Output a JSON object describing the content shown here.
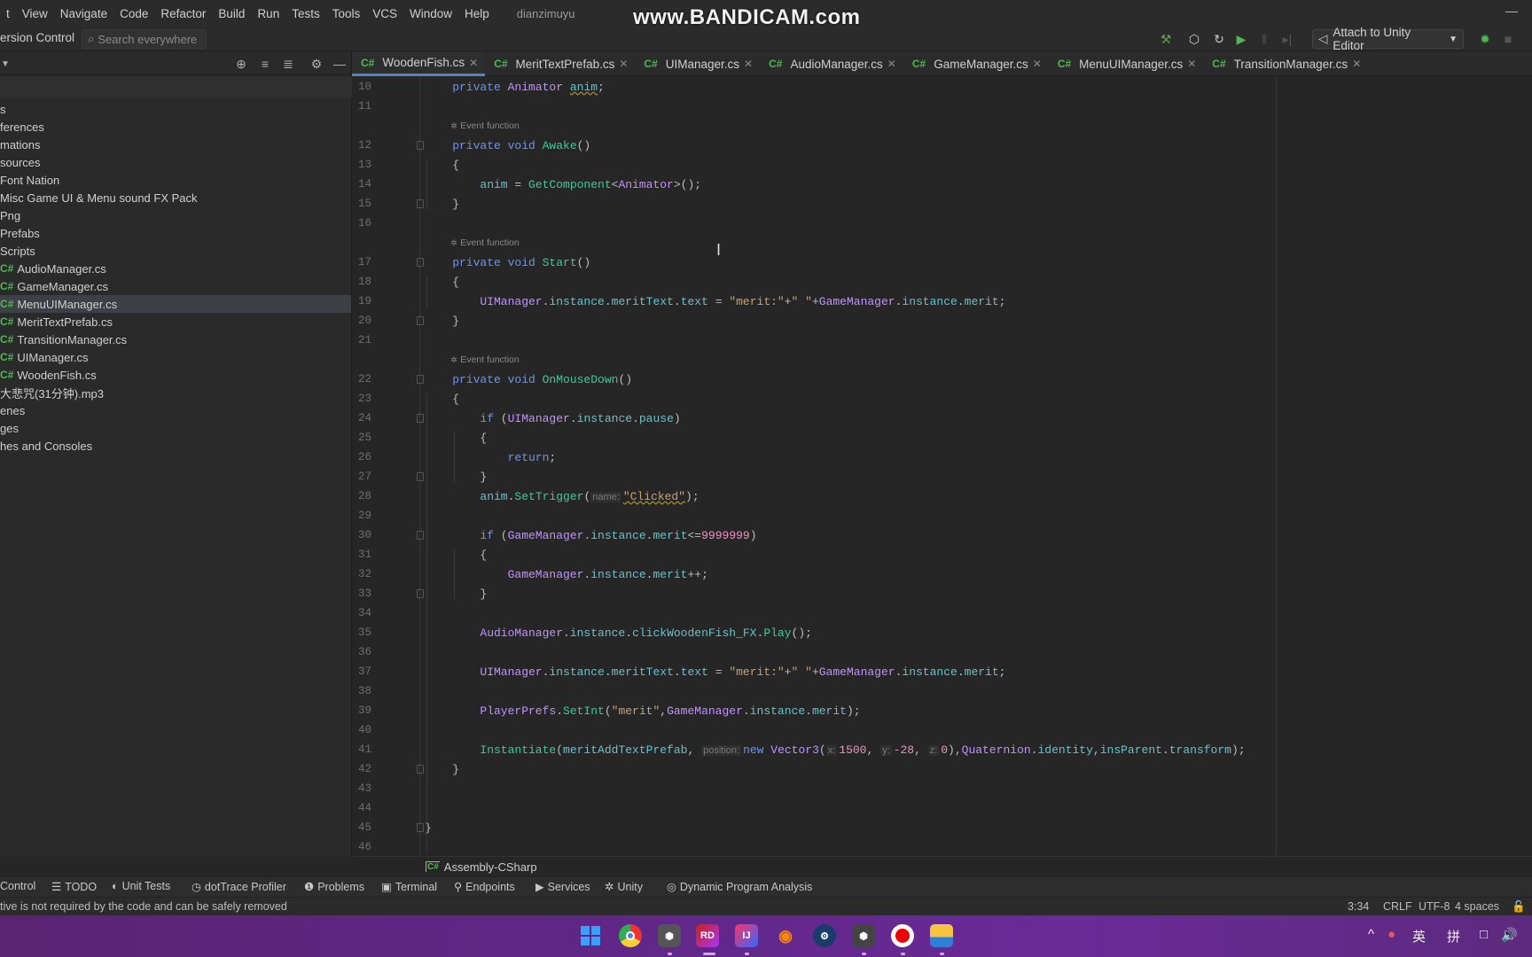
{
  "menubar": {
    "items": [
      "t",
      "View",
      "Navigate",
      "Code",
      "Refactor",
      "Build",
      "Run",
      "Tests",
      "Tools",
      "VCS",
      "Window",
      "Help"
    ],
    "project": "dianzimuyu"
  },
  "watermark": "www.BANDICAM.com",
  "toolbar": {
    "vcs_label": "ersion Control",
    "search_placeholder": "Search everywhere",
    "attach_label": "Attach to Unity Editor",
    "icons": [
      "hammer-icon",
      "unity-icon",
      "refresh-icon",
      "run-icon",
      "pause-icon",
      "step-icon",
      "debug-icon",
      "stop-icon"
    ]
  },
  "sidebar": {
    "items": [
      {
        "label": "s",
        "cs": false
      },
      {
        "label": "ferences",
        "cs": false
      },
      {
        "label": "mations",
        "cs": false
      },
      {
        "label": "sources",
        "cs": false
      },
      {
        "label": "Font Nation",
        "cs": false
      },
      {
        "label": "Misc Game UI & Menu sound FX Pack",
        "cs": false
      },
      {
        "label": "Png",
        "cs": false
      },
      {
        "label": "Prefabs",
        "cs": false
      },
      {
        "label": "Scripts",
        "cs": false
      },
      {
        "label": "AudioManager.cs",
        "cs": true
      },
      {
        "label": "GameManager.cs",
        "cs": true
      },
      {
        "label": "MenuUIManager.cs",
        "cs": true,
        "selected": true
      },
      {
        "label": "MeritTextPrefab.cs",
        "cs": true
      },
      {
        "label": "TransitionManager.cs",
        "cs": true
      },
      {
        "label": "UIManager.cs",
        "cs": true
      },
      {
        "label": "WoodenFish.cs",
        "cs": true
      },
      {
        "label": "大悲咒(31分钟).mp3",
        "cs": false
      },
      {
        "label": "enes",
        "cs": false
      },
      {
        "label": "ges",
        "cs": false
      },
      {
        "label": "hes and Consoles",
        "cs": false
      }
    ]
  },
  "tabs": [
    {
      "label": "WoodenFish.cs",
      "active": true
    },
    {
      "label": "MeritTextPrefab.cs"
    },
    {
      "label": "UIManager.cs"
    },
    {
      "label": "AudioManager.cs"
    },
    {
      "label": "GameManager.cs"
    },
    {
      "label": "MenuUIManager.cs"
    },
    {
      "label": "TransitionManager.cs"
    }
  ],
  "cs_badge": "C#",
  "editor": {
    "rows": [
      {
        "n": "10",
        "i": 1,
        "t": [
          [
            "kw",
            "private "
          ],
          [
            "cls",
            "Animator "
          ],
          [
            "fld u",
            "anim"
          ],
          [
            "p",
            ";"
          ]
        ]
      },
      {
        "n": "11"
      },
      {
        "hint": "Event function",
        "i": 1
      },
      {
        "n": "12",
        "i": 1,
        "f": 1,
        "t": [
          [
            "kw",
            "private void "
          ],
          [
            "mth",
            "Awake"
          ],
          [
            "p",
            "()"
          ]
        ]
      },
      {
        "n": "13",
        "i": 1,
        "t": [
          [
            "p",
            "{"
          ]
        ]
      },
      {
        "n": "14",
        "i": 2,
        "t": [
          [
            "fld",
            "anim"
          ],
          [
            "p",
            " = "
          ],
          [
            "mth",
            "GetComponent"
          ],
          [
            "p",
            "<"
          ],
          [
            "cls",
            "Animator"
          ],
          [
            "p",
            ">();"
          ]
        ]
      },
      {
        "n": "15",
        "i": 1,
        "f": 1,
        "t": [
          [
            "p",
            "}"
          ]
        ]
      },
      {
        "n": "16"
      },
      {
        "hint": "Event function",
        "i": 1
      },
      {
        "n": "17",
        "i": 1,
        "f": 1,
        "t": [
          [
            "kw",
            "private void "
          ],
          [
            "mth",
            "Start"
          ],
          [
            "p",
            "()"
          ]
        ]
      },
      {
        "n": "18",
        "i": 1,
        "t": [
          [
            "p",
            "{"
          ]
        ]
      },
      {
        "n": "19",
        "i": 2,
        "t": [
          [
            "cls",
            "UIManager"
          ],
          [
            "p",
            "."
          ],
          [
            "fld",
            "instance"
          ],
          [
            "p",
            "."
          ],
          [
            "fld",
            "meritText"
          ],
          [
            "p",
            "."
          ],
          [
            "fld",
            "text"
          ],
          [
            "p",
            " = "
          ],
          [
            "str",
            "\"merit:\""
          ],
          [
            "p",
            "+"
          ],
          [
            "str",
            "\" \""
          ],
          [
            "p",
            "+"
          ],
          [
            "cls",
            "GameManager"
          ],
          [
            "p",
            "."
          ],
          [
            "fld",
            "instance"
          ],
          [
            "p",
            "."
          ],
          [
            "fld",
            "merit"
          ],
          [
            "p",
            ";"
          ]
        ]
      },
      {
        "n": "20",
        "i": 1,
        "f": 1,
        "t": [
          [
            "p",
            "}"
          ]
        ]
      },
      {
        "n": "21"
      },
      {
        "hint": "Event function",
        "i": 1
      },
      {
        "n": "22",
        "i": 1,
        "f": 1,
        "t": [
          [
            "kw",
            "private void "
          ],
          [
            "mth",
            "OnMouseDown"
          ],
          [
            "p",
            "()"
          ]
        ]
      },
      {
        "n": "23",
        "i": 1,
        "t": [
          [
            "p",
            "{"
          ]
        ]
      },
      {
        "n": "24",
        "i": 2,
        "f": 1,
        "t": [
          [
            "kw",
            "if"
          ],
          [
            "p",
            " ("
          ],
          [
            "cls",
            "UIManager"
          ],
          [
            "p",
            "."
          ],
          [
            "fld",
            "instance"
          ],
          [
            "p",
            "."
          ],
          [
            "fld",
            "pause"
          ],
          [
            "p",
            ")"
          ]
        ]
      },
      {
        "n": "25",
        "i": 2,
        "t": [
          [
            "p",
            "{"
          ]
        ]
      },
      {
        "n": "26",
        "i": 3,
        "t": [
          [
            "kw",
            "return"
          ],
          [
            "p",
            ";"
          ]
        ]
      },
      {
        "n": "27",
        "i": 2,
        "f": 1,
        "t": [
          [
            "p",
            "}"
          ]
        ]
      },
      {
        "n": "28",
        "i": 2,
        "t": [
          [
            "fld",
            "anim"
          ],
          [
            "p",
            "."
          ],
          [
            "mth",
            "SetTrigger"
          ],
          [
            "p",
            "("
          ],
          [
            "ph",
            "name:"
          ],
          [
            "str u",
            "\"Clicked\""
          ],
          [
            "p",
            ");"
          ]
        ]
      },
      {
        "n": "29"
      },
      {
        "n": "30",
        "i": 2,
        "f": 1,
        "t": [
          [
            "kw",
            "if"
          ],
          [
            "p",
            " ("
          ],
          [
            "cls",
            "GameManager"
          ],
          [
            "p",
            "."
          ],
          [
            "fld",
            "instance"
          ],
          [
            "p",
            "."
          ],
          [
            "fld",
            "merit"
          ],
          [
            "p",
            "<="
          ],
          [
            "num",
            "9999999"
          ],
          [
            "p",
            ")"
          ]
        ]
      },
      {
        "n": "31",
        "i": 2,
        "t": [
          [
            "p",
            "{"
          ]
        ]
      },
      {
        "n": "32",
        "i": 3,
        "t": [
          [
            "cls",
            "GameManager"
          ],
          [
            "p",
            "."
          ],
          [
            "fld",
            "instance"
          ],
          [
            "p",
            "."
          ],
          [
            "fld",
            "merit"
          ],
          [
            "p",
            "++;"
          ]
        ]
      },
      {
        "n": "33",
        "i": 2,
        "f": 1,
        "t": [
          [
            "p",
            "}"
          ]
        ]
      },
      {
        "n": "34"
      },
      {
        "n": "35",
        "i": 2,
        "t": [
          [
            "cls",
            "AudioManager"
          ],
          [
            "p",
            "."
          ],
          [
            "fld",
            "instance"
          ],
          [
            "p",
            "."
          ],
          [
            "fld",
            "clickWoodenFish_FX"
          ],
          [
            "p",
            "."
          ],
          [
            "mth",
            "Play"
          ],
          [
            "p",
            "();"
          ]
        ]
      },
      {
        "n": "36"
      },
      {
        "n": "37",
        "i": 2,
        "t": [
          [
            "cls",
            "UIManager"
          ],
          [
            "p",
            "."
          ],
          [
            "fld",
            "instance"
          ],
          [
            "p",
            "."
          ],
          [
            "fld",
            "meritText"
          ],
          [
            "p",
            "."
          ],
          [
            "fld",
            "text"
          ],
          [
            "p",
            " = "
          ],
          [
            "str",
            "\"merit:\""
          ],
          [
            "p",
            "+"
          ],
          [
            "str",
            "\" \""
          ],
          [
            "p",
            "+"
          ],
          [
            "cls",
            "GameManager"
          ],
          [
            "p",
            "."
          ],
          [
            "fld",
            "instance"
          ],
          [
            "p",
            "."
          ],
          [
            "fld",
            "merit"
          ],
          [
            "p",
            ";"
          ]
        ]
      },
      {
        "n": "38"
      },
      {
        "n": "39",
        "i": 2,
        "t": [
          [
            "cls",
            "PlayerPrefs"
          ],
          [
            "p",
            "."
          ],
          [
            "mth",
            "SetInt"
          ],
          [
            "p",
            "("
          ],
          [
            "str",
            "\"merit\""
          ],
          [
            "p",
            ","
          ],
          [
            "cls",
            "GameManager"
          ],
          [
            "p",
            "."
          ],
          [
            "fld",
            "instance"
          ],
          [
            "p",
            "."
          ],
          [
            "fld",
            "merit"
          ],
          [
            "p",
            ");"
          ]
        ]
      },
      {
        "n": "40"
      },
      {
        "n": "41",
        "i": 2,
        "t": [
          [
            "mth",
            "Instantiate"
          ],
          [
            "p",
            "("
          ],
          [
            "fld",
            "meritAddTextPrefab"
          ],
          [
            "p",
            ", "
          ],
          [
            "ph",
            "position:"
          ],
          [
            "kw",
            "new "
          ],
          [
            "cls",
            "Vector3"
          ],
          [
            "p",
            "("
          ],
          [
            "ph",
            "x:"
          ],
          [
            "num",
            "1500"
          ],
          [
            "p",
            ", "
          ],
          [
            "ph",
            "y:"
          ],
          [
            "num",
            "-28"
          ],
          [
            "p",
            ", "
          ],
          [
            "ph",
            "z:"
          ],
          [
            "num",
            "0"
          ],
          [
            "p",
            "),"
          ],
          [
            "cls",
            "Quaternion"
          ],
          [
            "p",
            "."
          ],
          [
            "fld",
            "identity"
          ],
          [
            "p",
            ","
          ],
          [
            "fld",
            "insParent"
          ],
          [
            "p",
            "."
          ],
          [
            "fld",
            "transform"
          ],
          [
            "p",
            ");"
          ]
        ]
      },
      {
        "n": "42",
        "i": 1,
        "f": 1,
        "t": [
          [
            "p",
            "}"
          ]
        ]
      },
      {
        "n": "43"
      },
      {
        "n": "44"
      },
      {
        "n": "45",
        "i": 0,
        "f": 1,
        "t": [
          [
            "p",
            "}"
          ]
        ]
      },
      {
        "n": "46"
      }
    ]
  },
  "breadcrumb": "Assembly-CSharp",
  "toolwindows": [
    {
      "label": "Control",
      "icon": ""
    },
    {
      "label": "TODO",
      "icon": "☰"
    },
    {
      "label": "Unit Tests",
      "icon": "◐"
    },
    {
      "label": "dotTrace Profiler",
      "icon": "◷"
    },
    {
      "label": "Problems",
      "icon": "❶"
    },
    {
      "label": "Terminal",
      "icon": "▣"
    },
    {
      "label": "Endpoints",
      "icon": "⚲"
    },
    {
      "label": "Services",
      "icon": "▶"
    },
    {
      "label": "Unity",
      "icon": "✲"
    },
    {
      "label": "Dynamic Program Analysis",
      "icon": "◎"
    }
  ],
  "status": {
    "message": "tive is not required by the code and can be safely removed",
    "position": "3:34",
    "line_ending": "CRLF",
    "encoding": "UTF-8",
    "indent": "4 spaces"
  },
  "taskbar": {
    "apps": [
      "windows-start",
      "chrome",
      "unity-hub",
      "rider",
      "intellij",
      "blender",
      "steam",
      "unity",
      "bandicam",
      "file-explorer"
    ],
    "tray": {
      "chevron": "^",
      "lang1": "英",
      "lang2": "拼"
    }
  }
}
